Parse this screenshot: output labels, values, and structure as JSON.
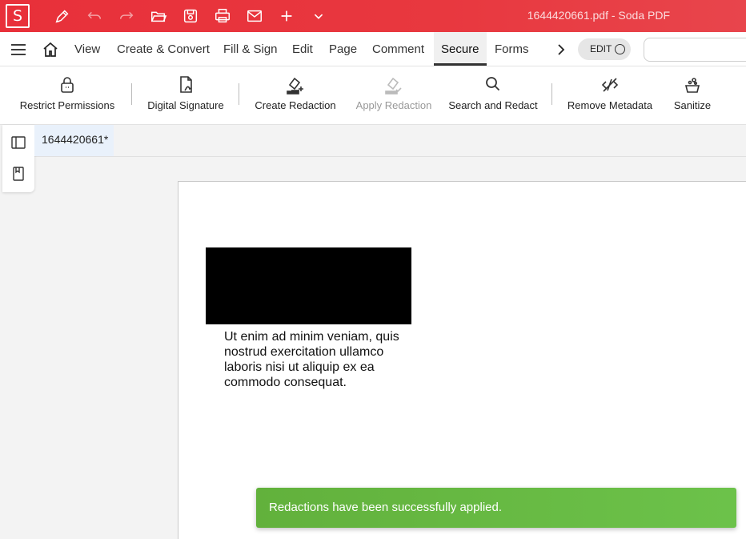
{
  "app": {
    "logo_letter": "S",
    "window_title": "1644420661.pdf   -   Soda PDF"
  },
  "quick_access": [
    "pen-icon",
    "undo-icon",
    "redo-icon",
    "open-folder-icon",
    "save-icon",
    "print-icon",
    "mail-icon",
    "plus-icon",
    "chevron-down-icon"
  ],
  "menu": {
    "items": [
      "View",
      "Create & Convert",
      "Fill & Sign",
      "Edit",
      "Page",
      "Comment",
      "Secure",
      "Forms"
    ],
    "active": "Secure",
    "edit_toggle": "EDIT"
  },
  "ribbon": {
    "tools": [
      {
        "label": "Restrict Permissions",
        "icon": "lock-icon",
        "enabled": true
      },
      {
        "label": "Digital Signature",
        "icon": "signature-file-icon",
        "enabled": true
      },
      {
        "label": "Create Redaction",
        "icon": "create-redaction-icon",
        "enabled": true
      },
      {
        "label": "Apply Redaction",
        "icon": "apply-redaction-icon",
        "enabled": false
      },
      {
        "label": "Search and Redact",
        "icon": "search-icon",
        "enabled": true
      },
      {
        "label": "Remove Metadata",
        "icon": "remove-metadata-icon",
        "enabled": true
      },
      {
        "label": "Sanitize",
        "icon": "sanitize-icon",
        "enabled": true
      }
    ]
  },
  "document": {
    "tab_label": "1644420661*",
    "body_text": "Ut enim ad minim veniam, quis nostrud exercitation ullamco laboris nisi ut aliquip ex ea commodo consequat."
  },
  "toast": {
    "message": "Redactions have been successfully applied.",
    "color": "#6ab944"
  }
}
